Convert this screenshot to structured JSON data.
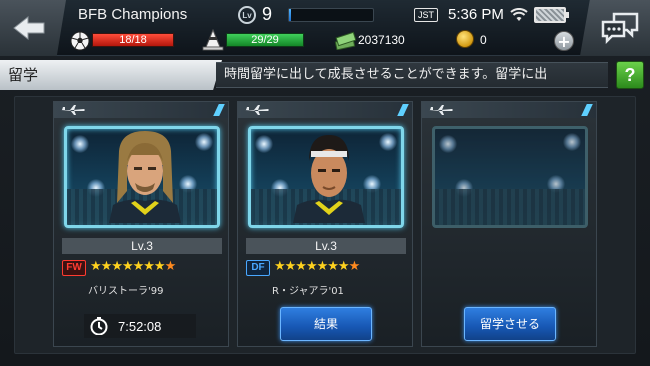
{
  "header": {
    "title": "BFB Champions",
    "level_icon_label": "Lv",
    "level": "9",
    "exp_progress": 0.02,
    "timezone": "JST",
    "time": "5:36 PM",
    "stamina": "18/18",
    "action_points": "29/29",
    "money": "2037130",
    "coins": "0",
    "plus_label": "+"
  },
  "section": {
    "title": "留学",
    "description": "時間留学に出して成長させることができます。留学に出",
    "help_label": "?"
  },
  "slots": [
    {
      "level": "Lv.3",
      "position": "FW",
      "stars": "★★★★★★★",
      "half_star": "★",
      "name": "バリストーラ'99",
      "timer": "7:52:08"
    },
    {
      "level": "Lv.3",
      "position": "DF",
      "stars": "★★★★★★★",
      "half_star": "★",
      "name": "R・ジャアラ'01",
      "button_label": "結果"
    },
    {
      "button_label": "留学させる"
    }
  ],
  "colors": {
    "accent_cyan": "#7fd6ea",
    "fw_red": "#ff3b30",
    "df_blue": "#4aa8ff",
    "button_blue": "#1757b3",
    "help_green": "#2c8a1c"
  },
  "icons": {
    "back": "back-arrow-icon",
    "chat": "chat-bubbles-icon",
    "wifi": "wifi-icon",
    "battery": "battery-icon",
    "ball": "soccer-ball-icon",
    "cone": "cone-icon",
    "money": "money-stack-icon",
    "coin": "coin-icon",
    "plane": "airplane-icon",
    "clock": "clock-icon"
  }
}
